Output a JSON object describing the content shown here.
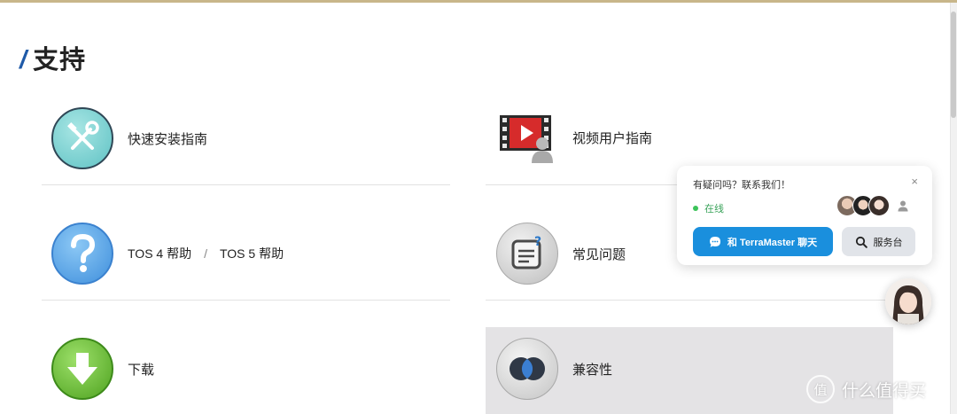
{
  "section": {
    "slash": "/",
    "title": "支持"
  },
  "items": {
    "quick_install": {
      "label": "快速安装指南",
      "icon": "tools-icon"
    },
    "video_guide": {
      "label": "视频用户指南",
      "icon": "video-play-icon"
    },
    "help": {
      "icon": "help-question-icon",
      "link1": "TOS 4 帮助",
      "sep": "/",
      "link2": "TOS 5 帮助"
    },
    "faq": {
      "label": "常见问题",
      "icon": "faq-note-icon"
    },
    "download": {
      "label": "下载",
      "icon": "download-arrow-icon"
    },
    "compatibility": {
      "label": "兼容性",
      "icon": "compatibility-icon"
    }
  },
  "chat": {
    "question": "有疑问吗？联系我们！",
    "close": "×",
    "status": "在线",
    "chat_button": "和 TerraMaster 聊天",
    "service_button": "服务台"
  },
  "watermark": {
    "logo": "值",
    "text": "什么值得买"
  },
  "colors": {
    "accent": "#1f5aa8",
    "chat_blue": "#1a8fdd",
    "online_green": "#3cc35a",
    "top_strip": "#c8b68a"
  }
}
